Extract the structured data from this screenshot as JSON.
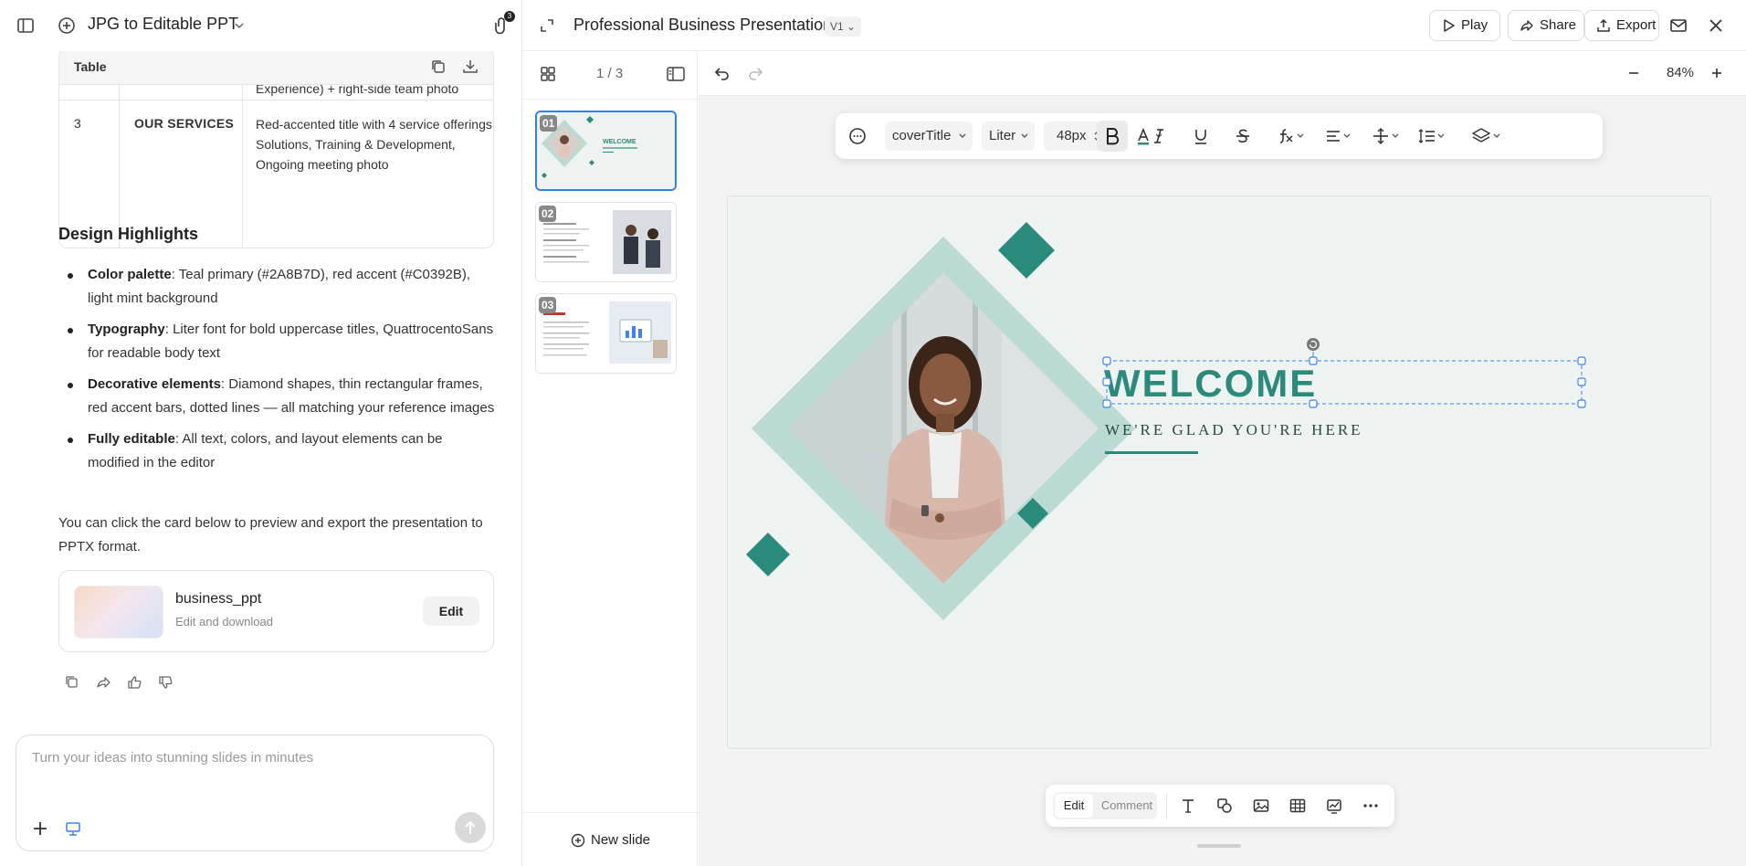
{
  "left_header": {
    "title": "JPG to Editable PPT",
    "attachment_count": "3"
  },
  "table_card": {
    "label": "Table",
    "cut_text": "Experience) + right-side team photo",
    "row": {
      "num": "3",
      "title": "OUR SERVICES",
      "desc": "Red-accented title with 4 service offerings: Solutions, Training & Development, Ongoing meeting photo"
    }
  },
  "design": {
    "heading": "Design Highlights",
    "items": [
      {
        "label": "Color palette",
        "text": ": Teal primary (#2A8B7D), red accent (#C0392B), light mint background"
      },
      {
        "label": "Typography",
        "text": ": Liter font for bold uppercase titles, QuattrocentoSans for readable body text"
      },
      {
        "label": "Decorative elements",
        "text": ": Diamond shapes, thin rectangular frames, red accent bars, dotted lines — all matching your reference images"
      },
      {
        "label": "Fully editable",
        "text": ": All text, colors, and layout elements can be modified in the editor"
      }
    ],
    "closing": "You can click the card below to preview and export the presentation to PPTX format."
  },
  "project_card": {
    "name": "business_ppt",
    "subtitle": "Edit and download",
    "edit_label": "Edit"
  },
  "composer": {
    "placeholder": "Turn your ideas into stunning slides in minutes"
  },
  "header": {
    "title": "Professional Business Presentation",
    "version": "V1",
    "play": "Play",
    "share": "Share",
    "export": "Export"
  },
  "thumbs": {
    "page_indicator": "1 / 3",
    "slides": [
      {
        "num": "01",
        "caption": "WELCOME"
      },
      {
        "num": "02"
      },
      {
        "num": "03"
      }
    ],
    "new_slide": "New slide"
  },
  "toolbar": {
    "zoom": "84%",
    "style": "coverTitle",
    "font": "Liter",
    "size": "48px"
  },
  "slide": {
    "title": "WELCOME",
    "subtitle": "WE'RE GLAD YOU'RE HERE"
  },
  "bottom_bar": {
    "edit": "Edit",
    "comment": "Comment"
  },
  "colors": {
    "teal": "#2A8B7D",
    "mint_bg": "#EEF3F1",
    "diamond_light": "#BCDAD4",
    "accent_blue": "#2F7FF5"
  }
}
